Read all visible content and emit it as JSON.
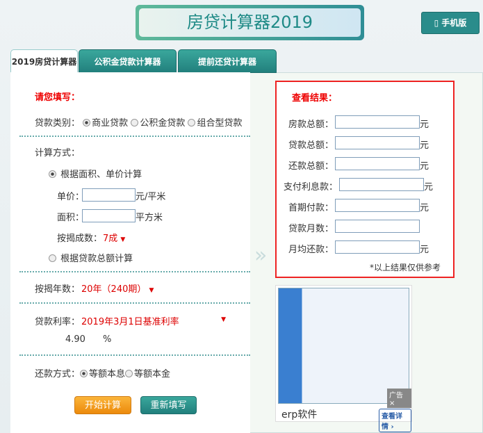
{
  "header": {
    "title": "房贷计算器2019",
    "mobile_label": "手机版"
  },
  "tabs": [
    {
      "label": "2019房贷计算器"
    },
    {
      "label": "公积金贷款计算器"
    },
    {
      "label": "提前还贷计算器"
    }
  ],
  "form": {
    "fill_title": "请您填写：",
    "loan_type_label": "贷款类别：",
    "loan_types": [
      "商业贷款",
      "公积金贷款",
      "组合型贷款"
    ],
    "calc_method_label": "计算方式：",
    "method_area": "根据面积、单价计算",
    "unit_price_label": "单价：",
    "unit_price_unit": "元/平米",
    "area_label": "面积：",
    "area_unit": "平方米",
    "ratio_label": "按揭成数：",
    "ratio_value": "7成",
    "method_total": "根据贷款总额计算",
    "years_label": "按揭年数：",
    "years_value": "20年（240期）",
    "rate_label": "贷款利率：",
    "rate_value": "2019年3月1日基准利率",
    "rate_number": "4.90",
    "rate_unit": "%",
    "repay_label": "还款方式：",
    "repay_options": [
      "等额本息",
      "等额本金"
    ],
    "start_button": "开始计算",
    "reset_button": "重新填写"
  },
  "results": {
    "title": "查看结果：",
    "rows": [
      {
        "label": "房款总额：",
        "unit": "元"
      },
      {
        "label": "贷款总额：",
        "unit": "元"
      },
      {
        "label": "还款总额：",
        "unit": "元"
      },
      {
        "label": "支付利息款：",
        "unit": "元"
      },
      {
        "label": "首期付款：",
        "unit": "元"
      },
      {
        "label": "贷款月数：",
        "unit": ""
      },
      {
        "label": "月均还款：",
        "unit": "元"
      }
    ],
    "note": "*以上结果仅供参考"
  },
  "ad": {
    "title": "erp软件",
    "button": "查看详情",
    "tag": "广告",
    "close": "×"
  }
}
